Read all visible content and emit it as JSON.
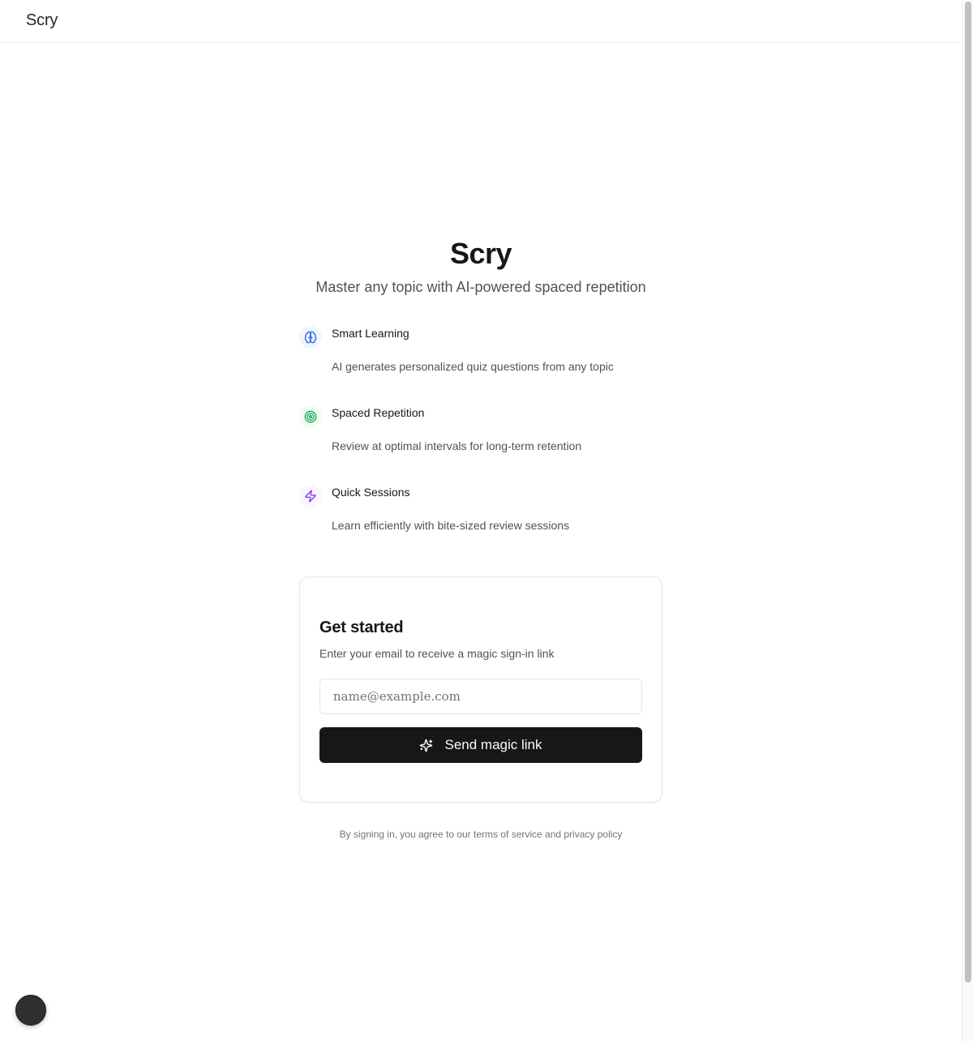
{
  "topbar": {
    "brand": "Scry"
  },
  "hero": {
    "title": "Scry",
    "subtitle": "Master any topic with AI-powered spaced repetition"
  },
  "features": [
    {
      "title": "Smart Learning",
      "description": "AI generates personalized quiz questions from any topic",
      "icon": "brain-icon",
      "color": "#2563eb",
      "bg": "#eff6ff"
    },
    {
      "title": "Spaced Repetition",
      "description": "Review at optimal intervals for long-term retention",
      "icon": "target-icon",
      "color": "#16a34a",
      "bg": "#f0fdf4"
    },
    {
      "title": "Quick Sessions",
      "description": "Learn efficiently with bite-sized review sessions",
      "icon": "zap-icon",
      "color": "#9333ea",
      "bg": "#faf5ff"
    }
  ],
  "signin": {
    "title": "Get started",
    "description": "Enter your email to receive a magic sign-in link",
    "email_value": "",
    "email_placeholder": "name@example.com",
    "button_label": "Send magic link",
    "button_icon": "sparkles-icon"
  },
  "legal": {
    "text": "By signing in, you agree to our terms of service and privacy policy"
  },
  "colors": {
    "primary": "#171717",
    "muted_text": "#525252",
    "border": "#e5e5e5"
  }
}
